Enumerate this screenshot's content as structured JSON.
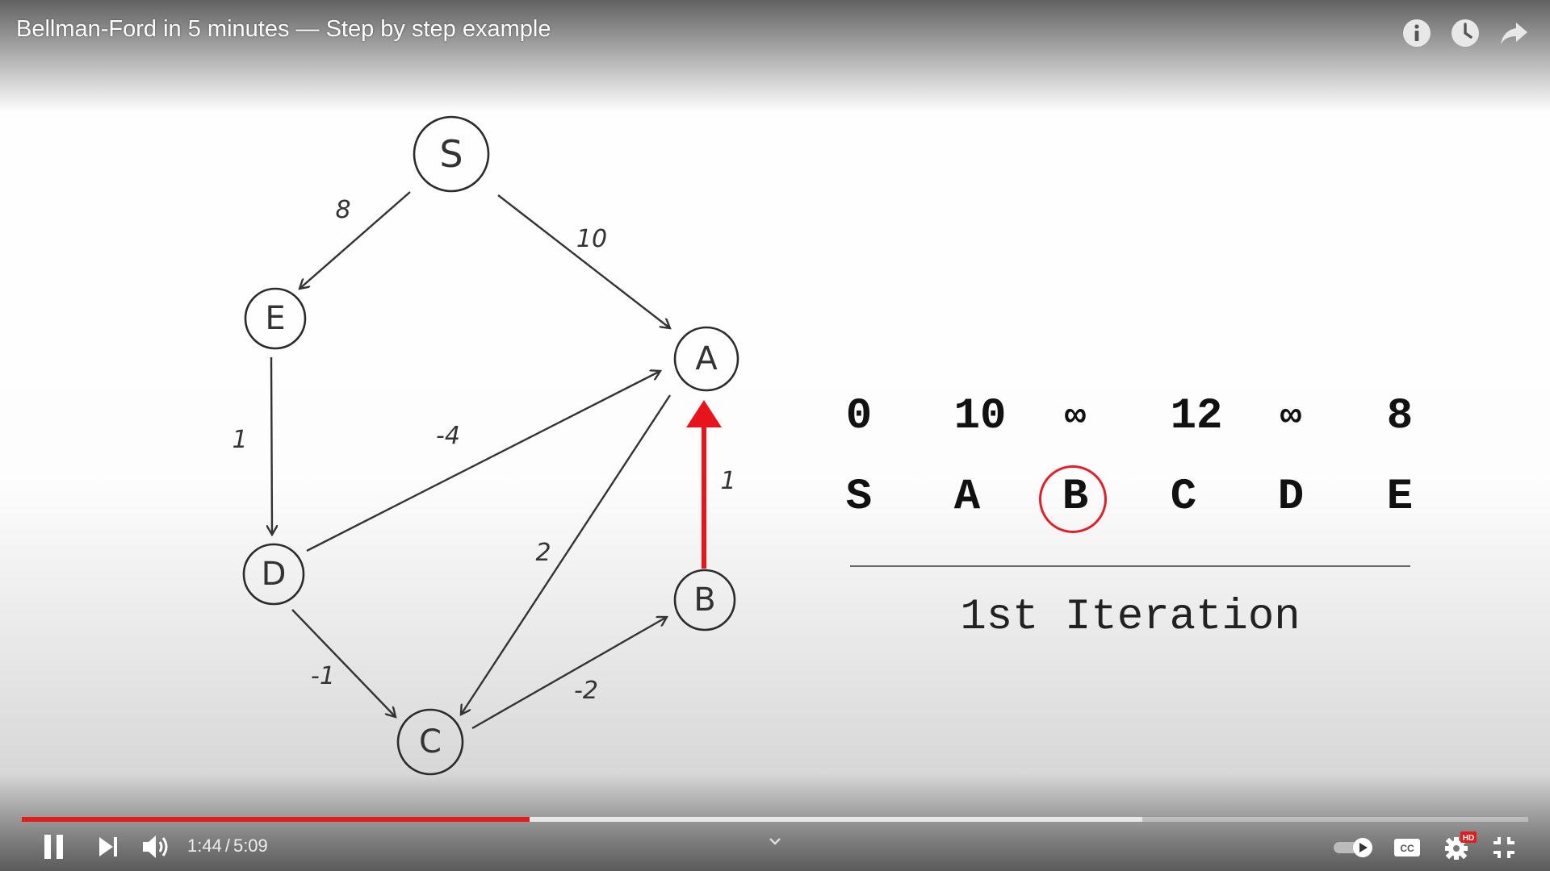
{
  "video": {
    "title": "Bellman-Ford in 5 minutes — Step by step example",
    "current_time": "1:44",
    "separator": "/",
    "duration": "5:09",
    "progress_played": 0.337,
    "progress_buffered": 0.744
  },
  "graph": {
    "nodes": [
      "S",
      "E",
      "A",
      "D",
      "B",
      "C"
    ],
    "edges": [
      {
        "from": "S",
        "to": "E",
        "weight": "8"
      },
      {
        "from": "S",
        "to": "A",
        "weight": "10"
      },
      {
        "from": "E",
        "to": "D",
        "weight": "1"
      },
      {
        "from": "D",
        "to": "A",
        "weight": "-4"
      },
      {
        "from": "A",
        "to": "C",
        "weight": "2"
      },
      {
        "from": "D",
        "to": "C",
        "weight": "-1"
      },
      {
        "from": "C",
        "to": "B",
        "weight": "-2"
      },
      {
        "from": "B",
        "to": "A",
        "weight": "1",
        "highlighted": true
      }
    ],
    "highlight_color": "#e8141c"
  },
  "distance_table": {
    "vertices": [
      "S",
      "A",
      "B",
      "C",
      "D",
      "E"
    ],
    "distances": [
      "0",
      "10",
      "∞",
      "12",
      "∞",
      "8"
    ],
    "circled_vertex": "B",
    "circle_color": "#e0202a"
  },
  "iteration_label": "1st Iteration",
  "icons": {
    "info": "info-icon",
    "watch_later": "clock-icon",
    "share": "share-icon",
    "pause": "pause-icon",
    "next": "next-icon",
    "volume": "volume-icon",
    "expand": "chevron-down-icon",
    "autoplay": "autoplay-toggle-icon",
    "captions": "cc-icon",
    "settings": "gear-icon",
    "settings_badge": "HD",
    "exit_fullscreen": "exit-fullscreen-icon"
  },
  "colors": {
    "progress_played": "#e21b1b",
    "hd_badge": "#e21b1b"
  }
}
